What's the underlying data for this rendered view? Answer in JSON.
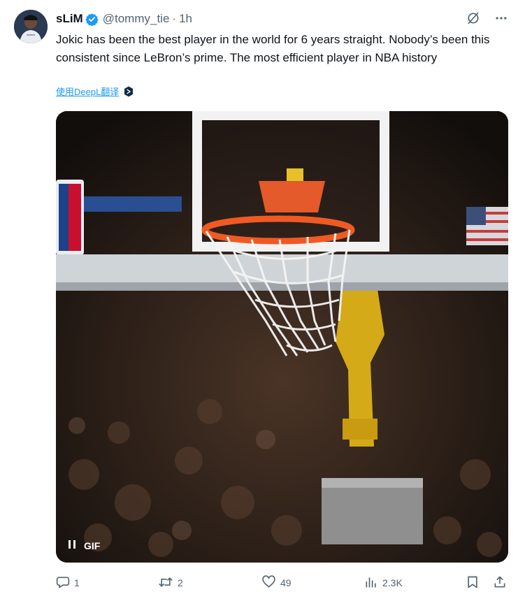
{
  "tweet": {
    "author_name": "sLiM",
    "handle": "@tommy_tie",
    "separator": "·",
    "time": "1h",
    "text": "Jokic has been the best player in the world for 6 years straight. Nobody’s been this consistent since LeBron’s prime. The most efficient player in NBA history",
    "translate_link": "使用DeepL翻译"
  },
  "media": {
    "gif_label": "GIF"
  },
  "actions": {
    "replies": "1",
    "retweets": "2",
    "likes": "49",
    "views": "2.3K"
  },
  "icons": {
    "verified": "verified-badge-icon",
    "grok": "grok-icon",
    "more": "more-icon",
    "translate_logo": "deepl-icon",
    "pause": "pause-icon",
    "reply": "reply-icon",
    "retweet": "retweet-icon",
    "like": "heart-icon",
    "views": "views-icon",
    "bookmark": "bookmark-icon",
    "share": "share-icon"
  },
  "colors": {
    "accent": "#1d9bf0",
    "text_primary": "#0f1419",
    "text_secondary": "#536471"
  }
}
